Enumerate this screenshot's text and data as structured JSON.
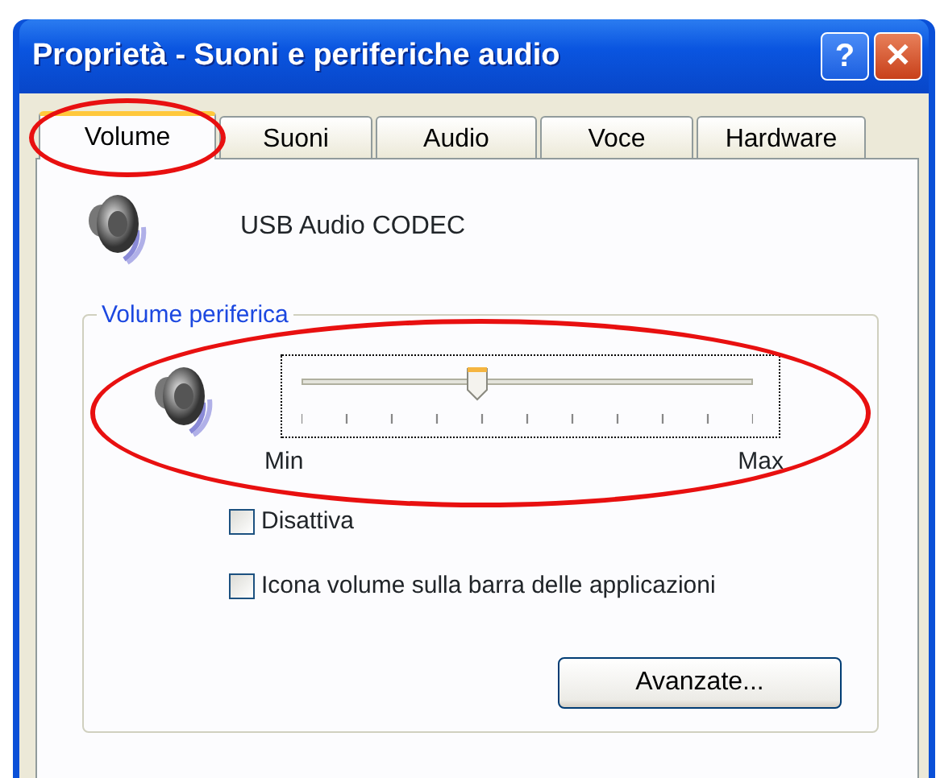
{
  "window": {
    "title": "Proprietà - Suoni e periferiche audio"
  },
  "title_buttons": [
    {
      "kind": "help",
      "label": "?"
    },
    {
      "kind": "close",
      "label": "✕"
    }
  ],
  "tabs": [
    {
      "label": "Volume",
      "selected": true,
      "circled": true
    },
    {
      "label": "Suoni",
      "selected": false,
      "circled": false
    },
    {
      "label": "Audio",
      "selected": false,
      "circled": false
    },
    {
      "label": "Voce",
      "selected": false,
      "circled": false
    },
    {
      "label": "Hardware",
      "selected": false,
      "circled": false
    }
  ],
  "device": {
    "name": "USB Audio CODEC"
  },
  "group": {
    "title": "Volume periferica",
    "slider": {
      "level": 0.39,
      "min_label": "Min",
      "max_label": "Max",
      "circled": true
    },
    "checkboxes": [
      {
        "label": "Disattiva",
        "checked": false
      },
      {
        "label": "Icona volume sulla barra delle applicazioni",
        "checked": false
      }
    ],
    "button": "Avanzate..."
  }
}
